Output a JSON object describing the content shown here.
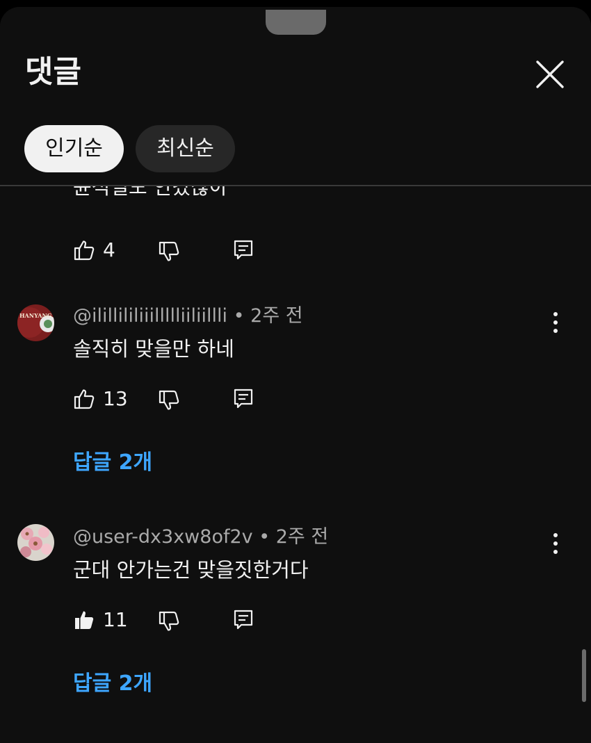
{
  "panel": {
    "title": "댓글",
    "close_icon": "close-icon"
  },
  "sort": {
    "options": [
      {
        "label": "인기순",
        "active": true
      },
      {
        "label": "최신순",
        "active": false
      }
    ]
  },
  "comments": [
    {
      "text": "윤석열도 안갔잖아",
      "likes": "4",
      "liked": false
    },
    {
      "author": "@ilillililiiillllliiliillli",
      "separator": "•",
      "time": "2주 전",
      "text": "솔직히 맞을만 하네",
      "likes": "13",
      "liked": false,
      "replies_label": "답글 2개",
      "avatar_text": "HANYANG UNIV"
    },
    {
      "author": "@user-dx3xw8of2v",
      "separator": "•",
      "time": "2주 전",
      "text": "군대 안가는건 맞을짓한거다",
      "likes": "11",
      "liked": true,
      "replies_label": "답글 2개"
    }
  ],
  "colors": {
    "background": "#0f0f0f",
    "text": "#f1f1f1",
    "secondary": "#aaaaaa",
    "link": "#3ea6ff",
    "chip_inactive": "#272727"
  }
}
